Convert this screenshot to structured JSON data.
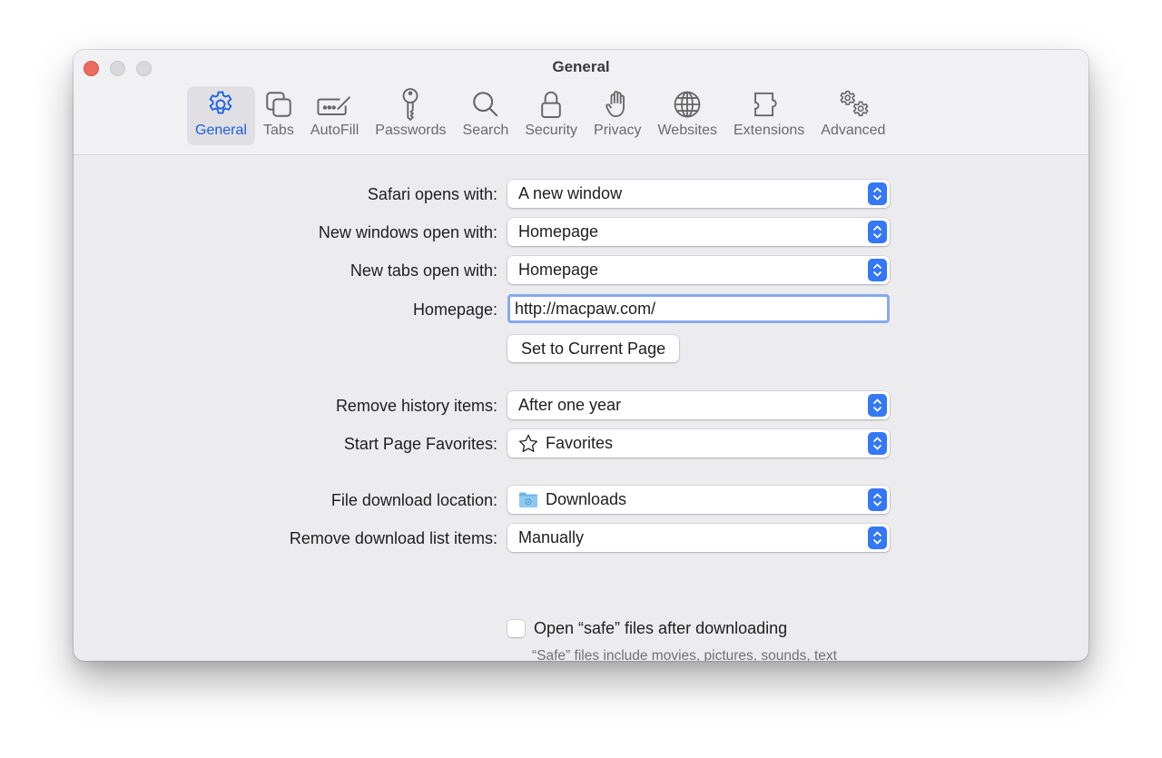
{
  "window": {
    "title": "General",
    "traffic_lights": [
      "close",
      "minimize",
      "zoom"
    ]
  },
  "toolbar": {
    "items": [
      {
        "label": "General",
        "icon": "gear-icon",
        "active": true
      },
      {
        "label": "Tabs",
        "icon": "tabs-icon",
        "active": false
      },
      {
        "label": "AutoFill",
        "icon": "autofill-icon",
        "active": false
      },
      {
        "label": "Passwords",
        "icon": "key-icon",
        "active": false
      },
      {
        "label": "Search",
        "icon": "search-icon",
        "active": false
      },
      {
        "label": "Security",
        "icon": "lock-icon",
        "active": false
      },
      {
        "label": "Privacy",
        "icon": "hand-icon",
        "active": false
      },
      {
        "label": "Websites",
        "icon": "globe-icon",
        "active": false
      },
      {
        "label": "Extensions",
        "icon": "puzzle-icon",
        "active": false
      },
      {
        "label": "Advanced",
        "icon": "gears-icon",
        "active": false
      }
    ]
  },
  "settings": {
    "safari_opens_with": {
      "label": "Safari opens with:",
      "value": "A new window"
    },
    "new_windows_open_with": {
      "label": "New windows open with:",
      "value": "Homepage"
    },
    "new_tabs_open_with": {
      "label": "New tabs open with:",
      "value": "Homepage"
    },
    "homepage": {
      "label": "Homepage:",
      "value": "http://macpaw.com/"
    },
    "set_current_page_button": "Set to Current Page",
    "remove_history_items": {
      "label": "Remove history items:",
      "value": "After one year"
    },
    "start_page_favorites": {
      "label": "Start Page Favorites:",
      "value": "Favorites",
      "icon": "star-icon"
    },
    "file_download_location": {
      "label": "File download location:",
      "value": "Downloads",
      "icon": "downloads-folder-icon"
    },
    "remove_download_list_items": {
      "label": "Remove download list items:",
      "value": "Manually"
    },
    "open_safe_files": {
      "label": "Open “safe” files after downloading",
      "checked": false
    },
    "safe_files_hint": "“Safe” files include movies, pictures, sounds, text documents, and archives."
  },
  "help_button": "?",
  "colors": {
    "accent": "#3478f6",
    "active_tab_text": "#1c5fe0",
    "close_button": "#ed6a5e",
    "focus_ring": "#86a8f0"
  }
}
